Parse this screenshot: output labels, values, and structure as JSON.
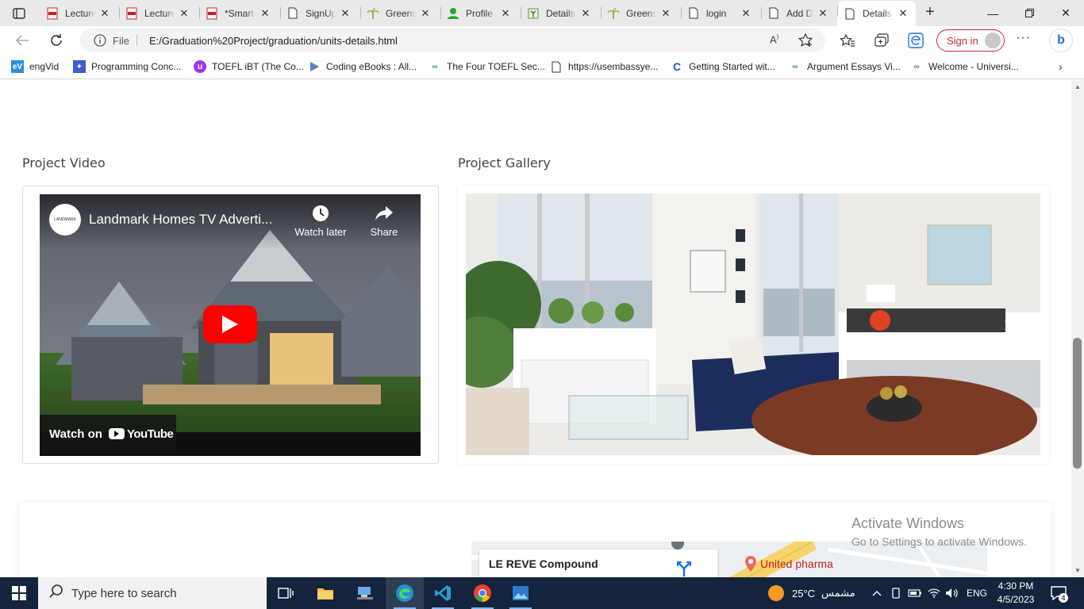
{
  "browser": {
    "tabs": [
      {
        "title": "Lecture",
        "icon": "pdf-icon",
        "active": false
      },
      {
        "title": "Lecture",
        "icon": "pdf-icon",
        "active": false
      },
      {
        "title": "*Smart",
        "icon": "pdf-icon",
        "active": false
      },
      {
        "title": "SignUp",
        "icon": "file-icon",
        "active": false
      },
      {
        "title": "Greens",
        "icon": "palm-tree-icon",
        "active": false
      },
      {
        "title": "Profile",
        "icon": "user-icon",
        "active": false
      },
      {
        "title": "Details",
        "icon": "plant-icon",
        "active": false
      },
      {
        "title": "Greens",
        "icon": "palm-tree-icon",
        "active": false
      },
      {
        "title": "login",
        "icon": "file-icon",
        "active": false
      },
      {
        "title": "Add D",
        "icon": "file-icon",
        "active": false
      },
      {
        "title": "Details",
        "icon": "file-icon",
        "active": true
      }
    ],
    "address": {
      "scheme_label": "File",
      "url": "E:/Graduation%20Project/graduation/units-details.html"
    },
    "signin_label": "Sign in",
    "favorites": [
      {
        "label": "engVid",
        "icon": "engvid-icon"
      },
      {
        "label": "Programming Conc...",
        "icon": "puzzle-icon"
      },
      {
        "label": "TOEFL iBT (The Co...",
        "icon": "udemy-icon"
      },
      {
        "label": "Coding eBooks : All...",
        "icon": "play-store-icon"
      },
      {
        "label": "The Four TOEFL Sec...",
        "icon": "link-icon"
      },
      {
        "label": "https://usembassye...",
        "icon": "file-icon"
      },
      {
        "label": "Getting Started wit...",
        "icon": "coursera-icon"
      },
      {
        "label": "Argument Essays Vi...",
        "icon": "link-icon"
      },
      {
        "label": "Welcome - Universi...",
        "icon": "link-icon"
      }
    ]
  },
  "page": {
    "video_section_title": "Project Video",
    "gallery_section_title": "Project Gallery",
    "video": {
      "title": "Landmark Homes TV Adverti...",
      "channel_logo_text": "LANDMARK",
      "watch_later_label": "Watch later",
      "share_label": "Share",
      "watch_on_label": "Watch on",
      "youtube_label": "YouTube"
    },
    "map": {
      "place_name": "LE REVE Compound",
      "place_address": "",
      "poi_label": "United pharma"
    }
  },
  "watermark": {
    "line1": "Activate Windows",
    "line2": "Go to Settings to activate Windows."
  },
  "taskbar": {
    "search_placeholder": "Type here to search",
    "weather_temp": "25°C",
    "weather_desc": "مشمس",
    "language": "ENG",
    "time": "4:30 PM",
    "date": "4/5/2023",
    "notification_count": "4"
  },
  "colors": {
    "signin_accent": "#c02b3a",
    "youtube_red": "#ff0000",
    "taskbar_bg": "#13243c"
  }
}
